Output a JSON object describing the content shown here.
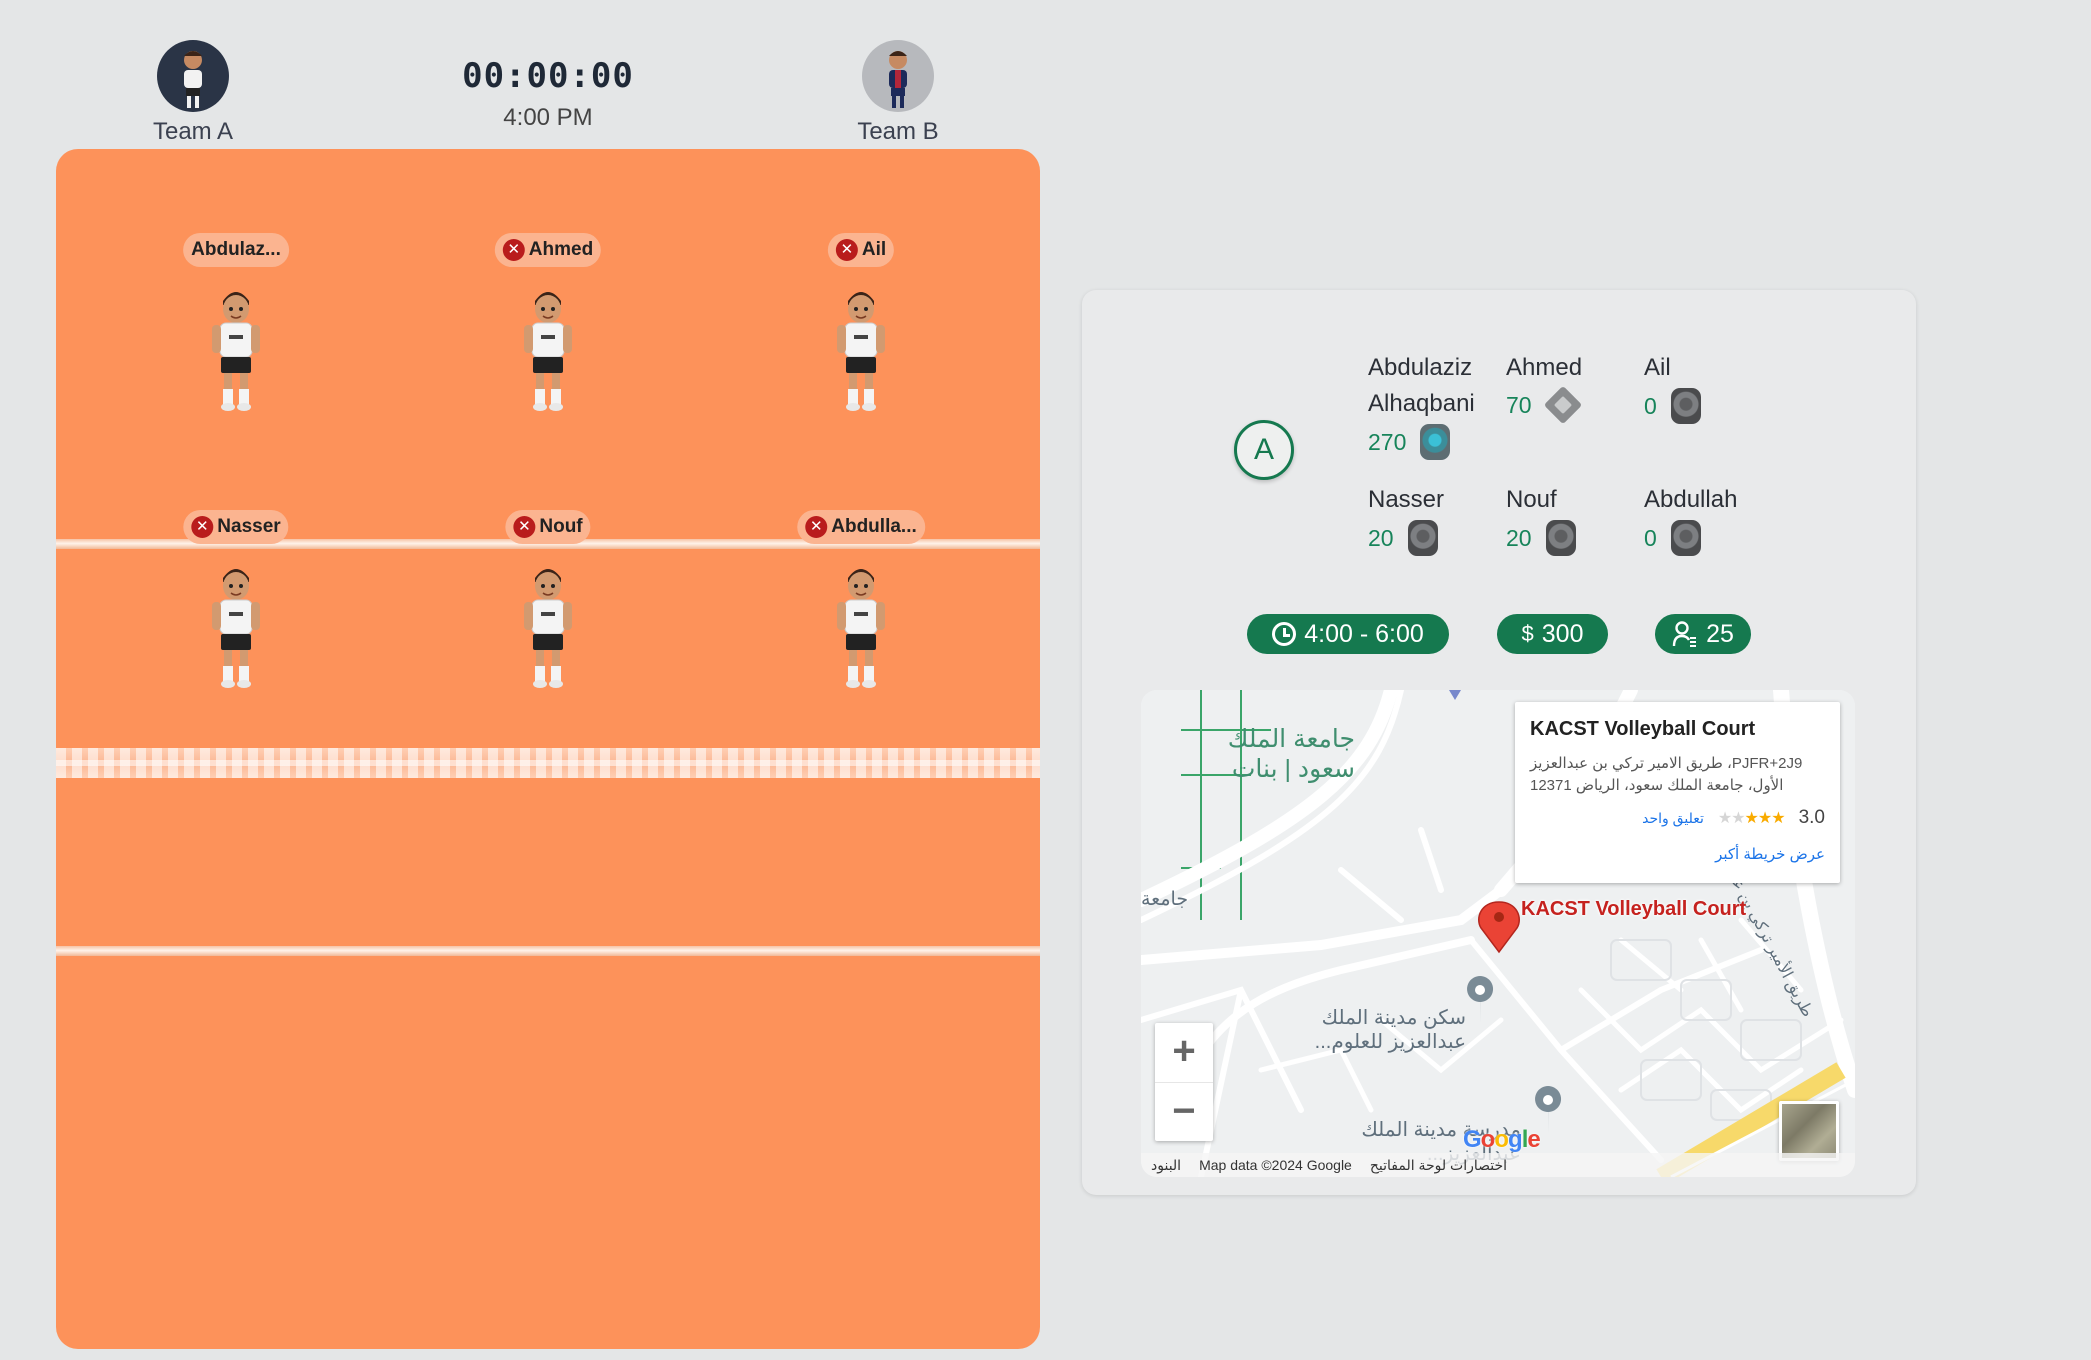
{
  "header": {
    "team_a": {
      "name": "Team A"
    },
    "team_b": {
      "name": "Team B"
    },
    "timer": "00:00:00",
    "start_time": "4:00 PM"
  },
  "court": {
    "players": [
      {
        "label": "Abdulaz...",
        "removable": false
      },
      {
        "label": "Ahmed",
        "removable": true
      },
      {
        "label": "Ail",
        "removable": true
      },
      {
        "label": "Nasser",
        "removable": true
      },
      {
        "label": "Nouf",
        "removable": true
      },
      {
        "label": "Abdulla...",
        "removable": true
      }
    ],
    "colors": {
      "court": "#fd925a",
      "remove": "#b91c1c"
    }
  },
  "details": {
    "team_badge": "A",
    "members": [
      {
        "name": "Abdulaziz Alhaqbani",
        "score": "270",
        "rank_icon": "diamond-rank-icon"
      },
      {
        "name": "Ahmed",
        "score": "70",
        "rank_icon": "silver-rank-icon"
      },
      {
        "name": "Ail",
        "score": "0",
        "rank_icon": "iron-rank-icon"
      },
      {
        "name": "Nasser",
        "score": "20",
        "rank_icon": "iron-rank-icon"
      },
      {
        "name": "Nouf",
        "score": "20",
        "rank_icon": "iron-rank-icon"
      },
      {
        "name": "Abdullah",
        "score": "0",
        "rank_icon": "iron-rank-icon"
      }
    ],
    "pills": {
      "time": "4:00 - 6:00",
      "price": "300",
      "price_symbol": "$",
      "capacity": "25"
    },
    "accent": "#15794f"
  },
  "map": {
    "info": {
      "title": "KACST Volleyball Court",
      "address": "PJFR+2J9، طريق الامير تركي بن عبدالعزيز الأول، جامعة الملك سعود، الرياض 12371",
      "rating": "3.0",
      "reviews": "تعليق واحد",
      "larger_map": "عرض خريطة أكبر"
    },
    "pin_label": "KACST Volleyball Court",
    "labels": {
      "university": "جامعة الملك سعود | بنات",
      "university_short": "جامعة",
      "housing": "سكن مدينة الملك عبدالعزيز للعلوم...",
      "school": "مدرسة مدينة الملك عبدالعزيز...",
      "road": "طريق الأمير تركي بن عبدالعزيز الأول"
    },
    "google": "Google",
    "attribution": {
      "terms": "البنود",
      "data": "Map data ©2024 Google",
      "shortcuts": "اختصارات لوحة المفاتيح"
    },
    "zoom_in": "+",
    "zoom_out": "−"
  }
}
